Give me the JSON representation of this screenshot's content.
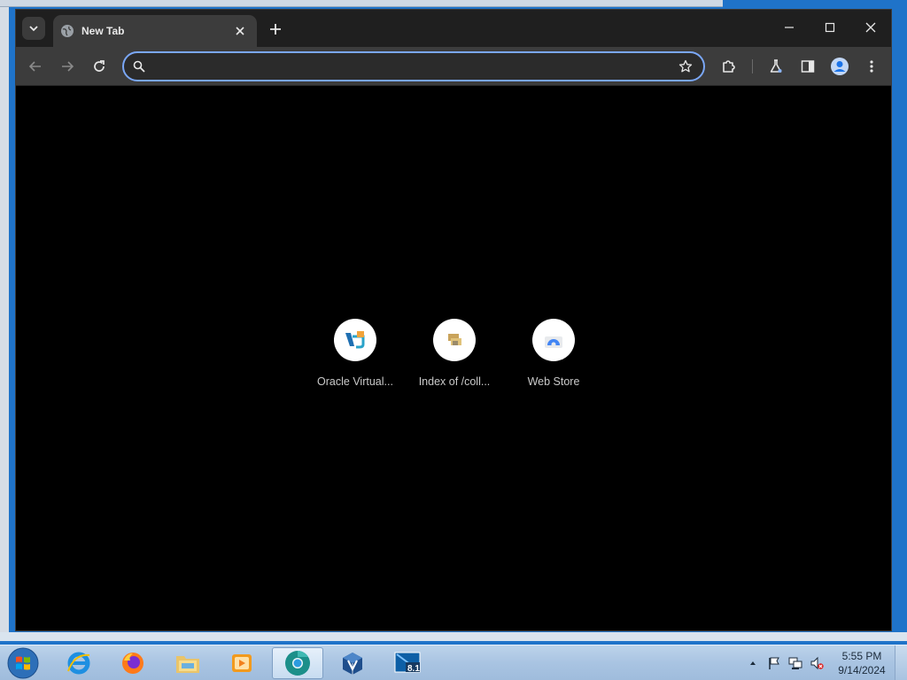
{
  "browser": {
    "tab": {
      "title": "New Tab"
    },
    "omnibox": {
      "value": "",
      "placeholder": ""
    },
    "accent_color": "#7aa7f6",
    "icons": [
      "tab-search-icon",
      "globe-icon",
      "close-icon",
      "plus-icon",
      "minimize-icon",
      "maximize-icon",
      "window-close-icon",
      "back-icon",
      "forward-icon",
      "reload-icon",
      "search-icon",
      "star-icon",
      "extensions-icon",
      "labs-icon",
      "side-panel-icon",
      "profile-icon",
      "menu-icon"
    ]
  },
  "shortcuts": [
    {
      "label": "Oracle Virtual..."
    },
    {
      "label": "Index of /coll..."
    },
    {
      "label": "Web Store"
    }
  ],
  "taskbar": {
    "apps": [
      "internet-explorer",
      "firefox",
      "file-explorer",
      "media-player",
      "chromium",
      "virtualbox",
      "hyper-v"
    ],
    "clock": {
      "time": "5:55 PM",
      "date": "9/14/2024"
    }
  }
}
